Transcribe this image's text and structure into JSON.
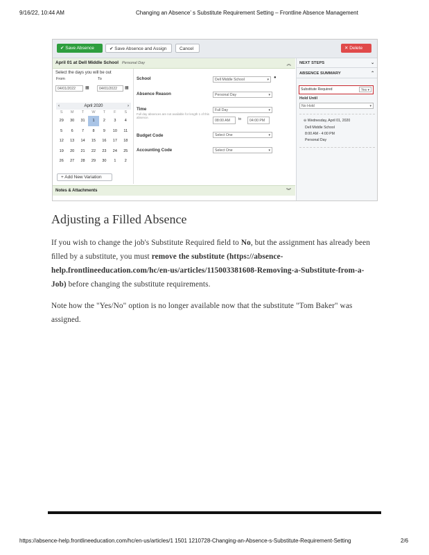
{
  "print_header": {
    "datetime": "9/16/22, 10:44 AM",
    "title": "Changing an Absence’ s Substitute Requirement Setting – Frontline Absence Management"
  },
  "screenshot": {
    "toolbar": {
      "save_absence": "Save Absence",
      "save_assign": "Save Absence and Assign",
      "cancel": "Cancel",
      "delete": "Delete"
    },
    "title": "April 01 at Dell Middle School",
    "title_extra": "Personal Day",
    "dates": {
      "prompt": "Select the days you will be out",
      "from_label": "From",
      "to_label": "To",
      "from_value": "04/01/2022",
      "to_value": "04/01/2022"
    },
    "calendar": {
      "month": "April 2020",
      "dow": [
        "S",
        "M",
        "T",
        "W",
        "T",
        "F",
        "S"
      ],
      "days": [
        "29",
        "30",
        "31",
        "1",
        "2",
        "3",
        "4",
        "5",
        "6",
        "7",
        "8",
        "9",
        "10",
        "11",
        "12",
        "13",
        "14",
        "15",
        "16",
        "17",
        "18",
        "19",
        "20",
        "21",
        "22",
        "23",
        "24",
        "25",
        "26",
        "27",
        "28",
        "29",
        "30",
        "1",
        "2"
      ],
      "selected_index": 3
    },
    "form": {
      "school_label": "School",
      "school_value": "Dell Middle School",
      "reason_label": "Absence Reason",
      "reason_value": "Personal Day",
      "time_label": "Time",
      "time_value": "Full Day",
      "time_hint": "Full day absences are not available for length 1 of this absence.",
      "start_time": "08:00 AM",
      "to": "to",
      "end_time": "04:00 PM",
      "budget_label": "Budget Code",
      "budget_value": "Select One",
      "accounting_label": "Accounting Code",
      "accounting_value": "Select One"
    },
    "add_variation": "Add New Variation",
    "notes": "Notes & Attachments",
    "sidebar": {
      "next_steps": "NEXT STEPS",
      "summary": "ABSENCE SUMMARY",
      "sub_required_label": "Substitute Required",
      "sub_required_value": "Yes",
      "hold_until": "Hold Until",
      "hold_value": "No Hold",
      "summary_day": "Wednesday, April 01, 2020",
      "summary_school": "Dell Middle School",
      "summary_time": "8:00 AM - 4:00 PM",
      "summary_reason": "Personal Day"
    }
  },
  "article": {
    "heading": "Adjusting a Filled Absence",
    "p1_a": "If you wish to change the job's Substitute Required ",
    "p1_b": "ﬁeld to ",
    "p1_no": "No",
    "p1_c": ", but the assignment has already been ﬁlled by a substitute, you must ",
    "p1_remove": "remove the substitute",
    "p1_link": " (https://absence-help.frontlineeducation.com/hc/en-us/articles/115003381608-Removing-a-Substitute-from-a-Job)",
    "p1_d": " before changing the substitute requirements.",
    "p2": "Note how the \"Yes/No\" option is no longer available now that the substitute \"Tom Baker\" was assigned."
  },
  "print_footer": {
    "url": "https://absence-help.frontlineeducation.com/hc/en-us/articles/1     1501 1210728-Changing-an-Absence-s-Substitute-Requirement-Setting",
    "page": "2/6"
  },
  "colors": {
    "accent_green": "#2e9e3e",
    "delete_red": "#e04a4a",
    "highlight_border": "#c8262c"
  }
}
